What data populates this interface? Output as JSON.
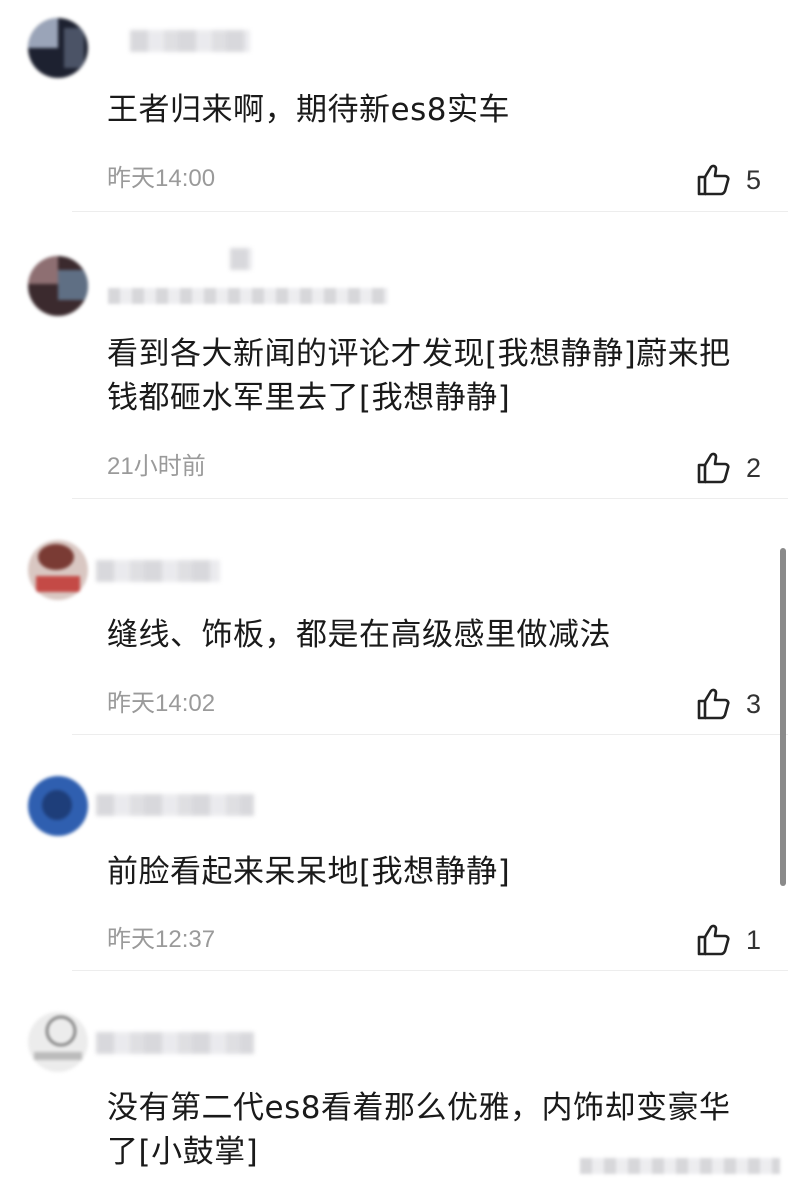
{
  "comments": [
    {
      "text": "王者归来啊，期待新es8实车",
      "time": "昨天14:00",
      "likes": "5"
    },
    {
      "text": "看到各大新闻的评论才发现[我想静静]蔚来把钱都砸水军里去了[我想静静]",
      "time": "21小时前",
      "likes": "2"
    },
    {
      "text": "缝线、饰板，都是在高级感里做减法",
      "time": "昨天14:02",
      "likes": "3"
    },
    {
      "text": "前脸看起来呆呆地[我想静静]",
      "time": "昨天12:37",
      "likes": "1"
    },
    {
      "text": "没有第二代es8看着那么优雅，内饰却变豪华了[小鼓掌]",
      "time": "",
      "likes": ""
    }
  ],
  "icons": {
    "like": "thumbs-up-outline-icon"
  },
  "colors": {
    "text": "#1a1a1a",
    "meta": "#9a9a9a",
    "divider": "#ededed"
  }
}
